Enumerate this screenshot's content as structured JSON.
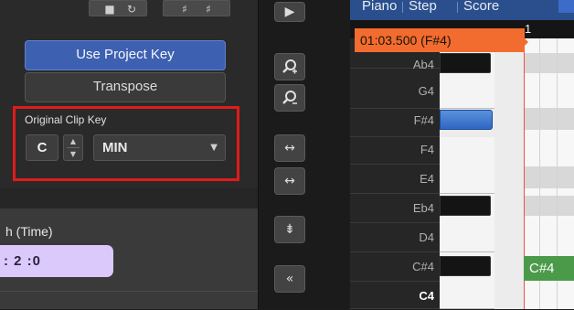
{
  "clip_key": {
    "use_project_key_label": "Use Project Key",
    "transpose_label": "Transpose",
    "original_clip_key_label": "Original Clip Key",
    "key_note": "C",
    "key_mode": "MIN"
  },
  "time_section": {
    "label": "h (Time)",
    "value": ": 2 :0"
  },
  "piano_roll": {
    "tabs": [
      "Piano",
      "Step",
      "Score"
    ],
    "position_readout": "01:03.500 (F#4)",
    "ruler_bar": "1",
    "key_labels": [
      "Ab4",
      "G4",
      "F#4",
      "F4",
      "E4",
      "Eb4",
      "D4",
      "C#4",
      "C4"
    ],
    "note_label": "C#4",
    "active_key": "F#4"
  },
  "colors": {
    "accent_blue": "#3e60b0",
    "marker_orange": "#f26c2f",
    "highlight_red": "#e01b1b",
    "time_field_lavender": "#dcc9fb",
    "note_green": "#4a9a4a"
  }
}
